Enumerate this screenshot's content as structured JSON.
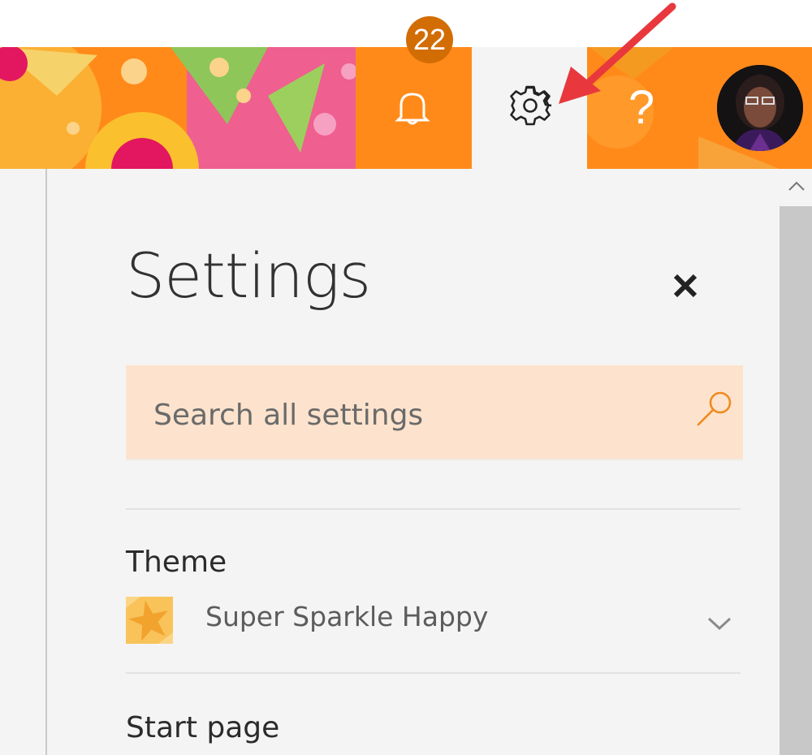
{
  "header": {
    "notifications": {
      "count": "22",
      "icon": "bell-icon"
    },
    "settings_icon": "gear-icon",
    "help": {
      "label": "?"
    },
    "avatar_icon": "avatar",
    "brand_color": "#ff8a1a"
  },
  "panel": {
    "title": "Settings",
    "close_icon": "close-icon",
    "search": {
      "placeholder": "Search all settings",
      "value": "",
      "icon": "search-icon"
    },
    "sections": [
      {
        "label": "Theme",
        "value": "Super Sparkle Happy",
        "icon": "chevron-down-icon"
      },
      {
        "label": "Start page"
      }
    ]
  },
  "colors": {
    "search_bg": "#fde3cd",
    "accent": "#ff8a1a",
    "annotation_arrow": "#e8383d"
  }
}
